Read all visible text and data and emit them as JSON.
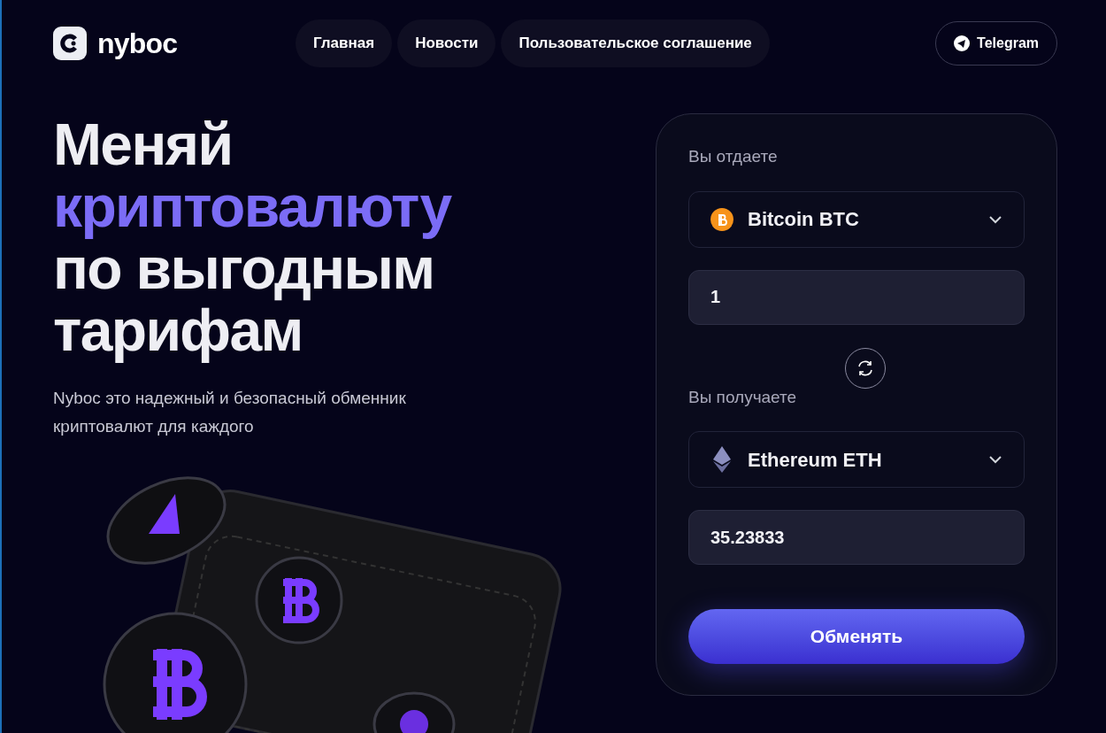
{
  "logo": {
    "text": "nyboc"
  },
  "nav": [
    {
      "label": "Главная"
    },
    {
      "label": "Новости"
    },
    {
      "label": "Пользовательское соглашение"
    }
  ],
  "telegram_button": {
    "label": "Telegram"
  },
  "hero": {
    "title_lines": [
      {
        "text": "Меняй",
        "accent": false
      },
      {
        "text": "криптовалюту",
        "accent": true
      },
      {
        "text": "по выгодным",
        "accent": false
      },
      {
        "text": "тарифам",
        "accent": false
      }
    ],
    "description": "Nyboc это надежный и безопасный обменник криптовалют для каждого"
  },
  "exchange": {
    "give_label": "Вы отдаете",
    "give_currency": {
      "name": "Bitcoin BTC",
      "kind": "btc"
    },
    "give_amount": "1",
    "receive_label": "Вы получаете",
    "receive_currency": {
      "name": "Ethereum ETH",
      "kind": "eth"
    },
    "receive_amount": "35.23833",
    "submit": "Обменять"
  }
}
